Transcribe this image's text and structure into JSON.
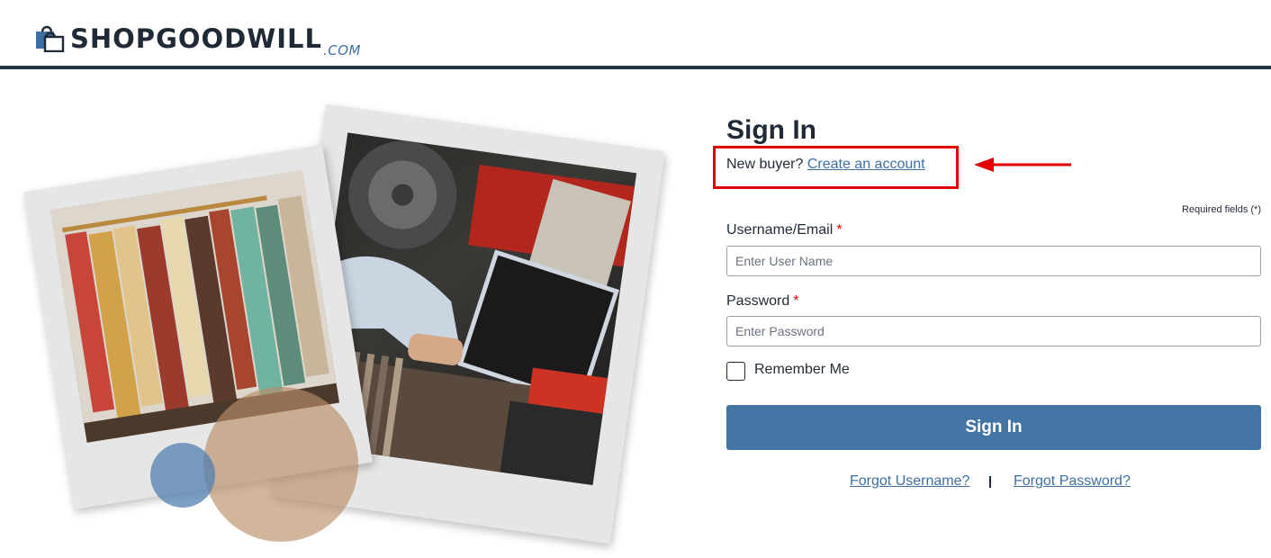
{
  "header": {
    "logo_word": "SHOPGOODWILL",
    "logo_suffix": ".COM"
  },
  "signin": {
    "title": "Sign In",
    "new_buyer_text": "New buyer?",
    "create_account_link": "Create an account",
    "required_note": "Required fields (*)",
    "username_label": "Username/Email",
    "username_placeholder": "Enter User Name",
    "password_label": "Password",
    "password_placeholder": "Enter Password",
    "required_star": "*",
    "remember_label": "Remember Me",
    "submit_label": "Sign In",
    "forgot_username": "Forgot Username?",
    "forgot_password": "Forgot Password?"
  },
  "colors": {
    "brand_dark": "#1f2a36",
    "brand_blue": "#3d6fa3",
    "button_blue": "#4274a6",
    "highlight_red": "#e00000"
  },
  "icons": [
    "shopping-bag-icon",
    "annotation-arrow-icon"
  ]
}
